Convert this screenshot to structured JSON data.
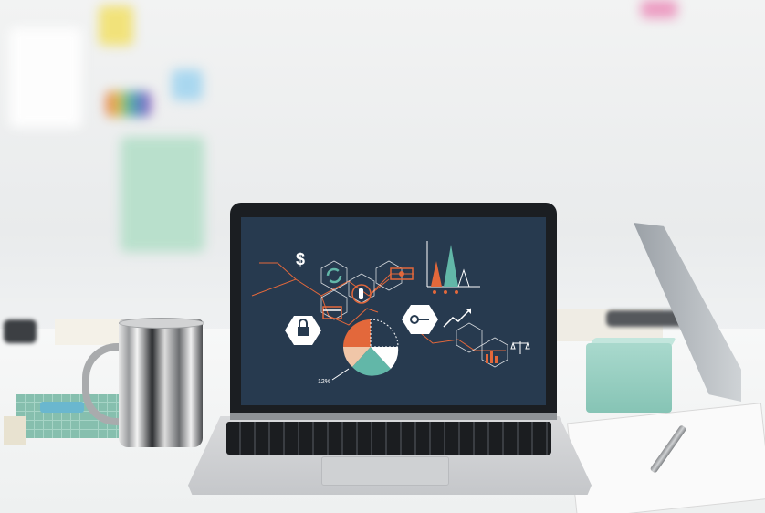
{
  "scene": {
    "description_labels": {
      "chart_percent_label": "12%",
      "currency_glyph": "$"
    },
    "colors": {
      "screen_bg": "#273a4f",
      "orange": "#e3683b",
      "teal": "#62b7a8",
      "peach": "#f0c6a8",
      "white": "#ffffff"
    },
    "icons": [
      "dollar-icon",
      "refresh-icon",
      "money-icon",
      "cursor-icon",
      "lock-icon",
      "card-icon",
      "key-icon",
      "trend-icon",
      "scale-icon",
      "pie-chart-icon",
      "bar-chart-icon"
    ]
  }
}
